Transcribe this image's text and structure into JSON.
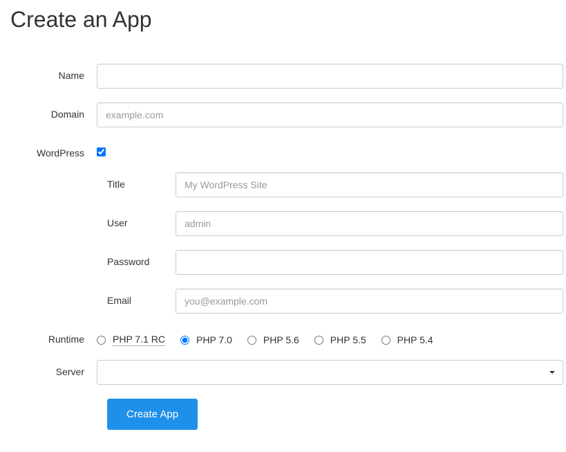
{
  "page_title": "Create an App",
  "labels": {
    "name": "Name",
    "domain": "Domain",
    "wordpress": "WordPress",
    "title": "Title",
    "user": "User",
    "password": "Password",
    "email": "Email",
    "runtime": "Runtime",
    "server": "Server"
  },
  "fields": {
    "name": {
      "value": ""
    },
    "domain": {
      "value": "",
      "placeholder": "example.com"
    },
    "wordpress": {
      "checked": true
    },
    "wp_title": {
      "value": "",
      "placeholder": "My WordPress Site"
    },
    "wp_user": {
      "value": "",
      "placeholder": "admin"
    },
    "wp_password": {
      "value": ""
    },
    "wp_email": {
      "value": "",
      "placeholder": "you@example.com"
    },
    "runtime": {
      "options": [
        {
          "label": "PHP 7.1 RC",
          "value": "php71rc",
          "dotted": true
        },
        {
          "label": "PHP 7.0",
          "value": "php70",
          "dotted": false
        },
        {
          "label": "PHP 5.6",
          "value": "php56",
          "dotted": false
        },
        {
          "label": "PHP 5.5",
          "value": "php55",
          "dotted": false
        },
        {
          "label": "PHP 5.4",
          "value": "php54",
          "dotted": false
        }
      ],
      "selected": "php70"
    },
    "server": {
      "selected": ""
    }
  },
  "buttons": {
    "submit": "Create App"
  }
}
